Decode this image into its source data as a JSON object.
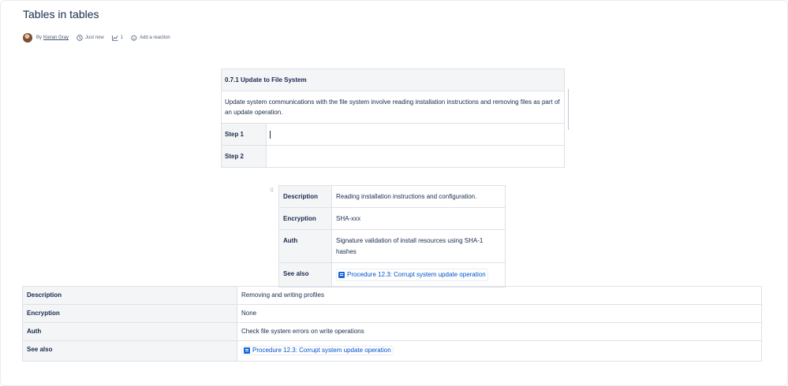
{
  "page": {
    "title": "Tables in tables"
  },
  "byline": {
    "by": "By",
    "author": "Kieran Gray",
    "time": "Just now",
    "views": "1",
    "reaction": "Add a reaction"
  },
  "table1": {
    "heading": "0.7.1 Update to File System",
    "body": "Update system communications with the file system involve reading installation instructions and removing files as part of an update operation.",
    "steps": [
      {
        "label": "Step 1",
        "value": ""
      },
      {
        "label": "Step 2",
        "value": ""
      }
    ]
  },
  "table2": {
    "rows": [
      {
        "label": "Description",
        "value": "Reading installation instructions and configuration."
      },
      {
        "label": "Encryption",
        "value": "SHA-xxx"
      },
      {
        "label": "Auth",
        "value": "Signature validation of install resources using SHA-1 hashes"
      },
      {
        "label": "See also",
        "link": "Procedure 12.3: Corrupt system update operation"
      }
    ]
  },
  "table3": {
    "rows": [
      {
        "label": "Description",
        "value": "Removing and writing profiles"
      },
      {
        "label": "Encryption",
        "value": "None"
      },
      {
        "label": "Auth",
        "value": "Check file system errors on write operations"
      },
      {
        "label": "See also",
        "link": "Procedure 12.3: Corrupt system update operation"
      }
    ]
  },
  "colors": {
    "link": "#0052cc",
    "header_bg": "#f4f5f7",
    "border": "#dfe1e6"
  },
  "icons": [
    "clock-icon",
    "analytics-icon",
    "add-reaction-icon",
    "document-icon",
    "drag-handle-icon"
  ]
}
